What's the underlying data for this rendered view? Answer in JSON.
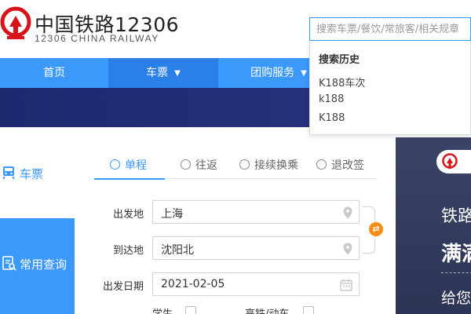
{
  "brand": {
    "title": "中国铁路12306",
    "subtitle": "12306 CHINA RAILWAY"
  },
  "search": {
    "placeholder": "搜索车票/餐饮/常旅客/相关规章",
    "history_title": "搜索历史",
    "history": [
      "K188车次",
      "k188",
      "K188"
    ]
  },
  "nav": {
    "items": [
      {
        "label": "首页",
        "has_dropdown": false
      },
      {
        "label": "车票",
        "has_dropdown": true,
        "active": true
      },
      {
        "label": "团购服务",
        "has_dropdown": true
      }
    ]
  },
  "sidebar": {
    "ticket_label": "车票",
    "query_label": "常用查询"
  },
  "tabs": [
    {
      "label": "单程",
      "active": true
    },
    {
      "label": "往返"
    },
    {
      "label": "接续换乘"
    },
    {
      "label": "退改签"
    }
  ],
  "form": {
    "from_label": "出发地",
    "from_value": "上海",
    "to_label": "到达地",
    "to_value": "沈阳北",
    "date_label": "出发日期",
    "date_value": "2021-02-05",
    "student_label": "学生",
    "highspeed_label": "高铁/动车"
  },
  "ad": {
    "line1": "铁路",
    "line2": "满满",
    "line3": "给您"
  },
  "colors": {
    "primary": "#3b99fc",
    "accent_orange": "#fa8c16",
    "logo_red": "#d9121a",
    "banner_navy": "#1e2a6e"
  },
  "icons": {
    "location": "location-pin-icon",
    "calendar": "calendar-icon",
    "swap": "swap-icon",
    "logo": "railway-logo-icon"
  }
}
